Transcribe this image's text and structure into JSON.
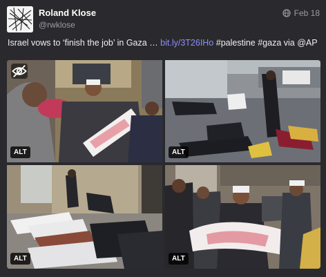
{
  "author": {
    "display_name": "Roland Klose",
    "handle": "@rwklose",
    "avatar_icon": "abstract-line-drawing-avatar"
  },
  "post": {
    "date": "Feb 18",
    "visibility_icon": "globe-icon",
    "text_before": "Israel vows to ‘finish the job’ in Gaza … ",
    "link": "bit.ly/3T26IHo",
    "text_after": " #palestine #gaza via @AP"
  },
  "media": {
    "hide_icon": "eye-slash-icon",
    "items": [
      {
        "alt_label": "ALT"
      },
      {
        "alt_label": "ALT"
      },
      {
        "alt_label": "ALT"
      },
      {
        "alt_label": "ALT"
      }
    ]
  },
  "colors": {
    "background": "#2a2a2e",
    "link": "#8c8dff",
    "muted": "#9a9aa5"
  }
}
